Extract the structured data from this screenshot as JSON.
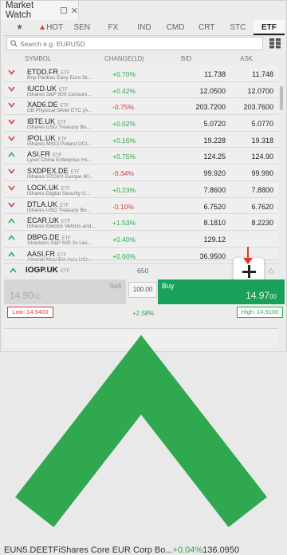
{
  "window": {
    "title": "Market Watch"
  },
  "tabs": [
    {
      "label": "★",
      "active": false
    },
    {
      "label": "HOT",
      "active": false
    },
    {
      "label": "SEN",
      "active": false
    },
    {
      "label": "FX",
      "active": false
    },
    {
      "label": "IND",
      "active": false
    },
    {
      "label": "CMD",
      "active": false
    },
    {
      "label": "CRT",
      "active": false
    },
    {
      "label": "STC",
      "active": false
    },
    {
      "label": "ETF",
      "active": true
    }
  ],
  "search": {
    "placeholder": "Search e.g. EURUSD"
  },
  "columns": {
    "symbol": "SYMBOL",
    "change": "CHANGE(1D)",
    "bid": "BID",
    "ask": "ASK"
  },
  "etf_tag": "ETF",
  "rows": [
    {
      "symbol": "ETDD.FR",
      "desc": "Bnp Paribas Easy Euro St...",
      "change": "+0.70%",
      "dir": "down",
      "bid": "11.738",
      "ask": "11.748"
    },
    {
      "symbol": "IUCD.UK",
      "desc": "iShares S&P 500 Consum...",
      "change": "+0.42%",
      "dir": "down",
      "bid": "12.0500",
      "ask": "12.0700"
    },
    {
      "symbol": "XAD6.DE",
      "desc": "DB Physical Silver ETC (A...",
      "change": "-0.75%",
      "dir": "down",
      "bid": "203.7200",
      "ask": "203.7600"
    },
    {
      "symbol": "IBTE.UK",
      "desc": "iShares USD Treasury Bo...",
      "change": "+0.02%",
      "dir": "down",
      "bid": "5.0720",
      "ask": "5.0770"
    },
    {
      "symbol": "IPOL.UK",
      "desc": "iShares MSCI Poland UCI...",
      "change": "+0.16%",
      "dir": "down",
      "bid": "19.228",
      "ask": "19.318"
    },
    {
      "symbol": "ASI.FR",
      "desc": "Lyxor China Enterprise Hs...",
      "change": "+0.75%",
      "dir": "up",
      "bid": "124.25",
      "ask": "124.90"
    },
    {
      "symbol": "SXDPEX.DE",
      "desc": "iShares STOXX Europe 60...",
      "change": "-0.34%",
      "dir": "down",
      "bid": "99.920",
      "ask": "99.990"
    },
    {
      "symbol": "LOCK.UK",
      "desc": "iShares Digital Security U...",
      "change": "+0.23%",
      "dir": "down",
      "bid": "7.8600",
      "ask": "7.8800"
    },
    {
      "symbol": "DTLA.UK",
      "desc": "iShares USD Treasury Bo...",
      "change": "-0.10%",
      "dir": "down",
      "bid": "6.7520",
      "ask": "6.7620"
    },
    {
      "symbol": "ECAR.UK",
      "desc": "iShares Electric Vehicls and...",
      "change": "+1.53%",
      "dir": "up",
      "bid": "8.1810",
      "ask": "8.2230"
    },
    {
      "symbol": "DBPG.DE",
      "desc": "Xtrackers S&P 500 2x Lev...",
      "change": "+0.40%",
      "dir": "up",
      "bid": "129.12",
      "ask": ""
    },
    {
      "symbol": "AASI.FR",
      "desc": "Amundi Msci Em Asia UCI...",
      "change": "+0.60%",
      "dir": "up",
      "bid": "36.9500",
      "ask": ""
    }
  ],
  "expanded": {
    "symbol": "IOGP.UK",
    "qty_label": "650",
    "sell_label": "Sell",
    "sell_price": "14.90",
    "sell_price_small": "00",
    "buy_label": "Buy",
    "buy_price": "14.97",
    "buy_price_small": "00",
    "qty_value": "100.00",
    "low": "Low: 14.5400",
    "high": "High: 14.9100",
    "spread": "+2.58%"
  },
  "last_row": {
    "symbol": "EUN5.DE",
    "desc": "iShares Core EUR Corp Bo...",
    "change": "+0.04%",
    "dir": "up",
    "bid": "136.0950",
    "ask": ""
  },
  "colors": {
    "up": "#2fa84f",
    "down": "#d93a3a",
    "buy": "#19a15a",
    "hot": "#e0392b"
  }
}
